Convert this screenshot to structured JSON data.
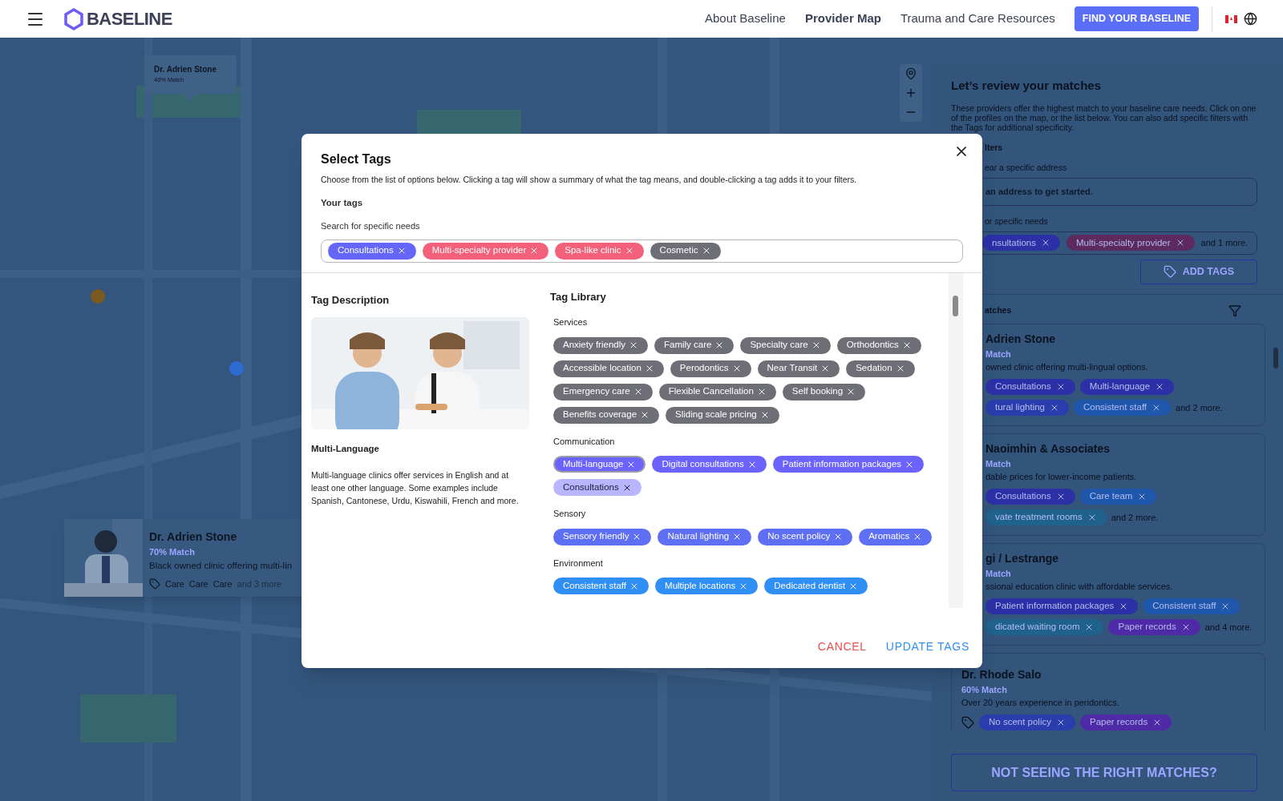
{
  "header": {
    "logo": "BASELINE",
    "nav": [
      {
        "label": "About Baseline",
        "selected": false
      },
      {
        "label": "Provider Map",
        "selected": true
      },
      {
        "label": "Trauma and Care Resources",
        "selected": false
      }
    ],
    "cta": "FIND YOUR BASELINE"
  },
  "map": {
    "popup": {
      "name": "Dr. Adrien Stone",
      "match": "40% Match"
    },
    "card": {
      "name": "Dr. Adrien Stone",
      "match": "70% Match",
      "description": "Black owned clinic offering multi-lin",
      "tags": [
        "Care",
        "Care",
        "Care"
      ],
      "more": "and 3 more"
    }
  },
  "panel": {
    "title": "Let’s review your matches",
    "intro": "These providers offer the highest match to your baseline care needs. Click on one of the profiles on the map, or the list below. You can also add specific filters with the Tags for additional specificity.",
    "filters_heading": "lters",
    "address_label": "ear a specific address",
    "address_placeholder": "an address to get started.",
    "needs_label": "or specific needs",
    "needs_tags": [
      {
        "label": "nsultations",
        "color": "#2b30a6"
      },
      {
        "label": "Multi-specialty provider",
        "color": "#5c2a5e"
      }
    ],
    "needs_more": "and 1 more.",
    "add_tags": "ADD TAGS",
    "matches_heading": "atches",
    "matches": [
      {
        "name": "Adrien Stone",
        "match": "Match",
        "description": "owned clinic offering multi-lingual options.",
        "tag_icon": false,
        "rows": [
          [
            {
              "label": "Consultations",
              "color": "#2b30a6"
            },
            {
              "label": "Multi-language",
              "color": "#2b30a6"
            }
          ],
          [
            {
              "label": "tural lighting",
              "color": "#2b3cac"
            },
            {
              "label": "Consistent staff",
              "color": "#1f57ad"
            }
          ]
        ],
        "more": "and 2 more."
      },
      {
        "name": "Naoimhin & Associates",
        "match": "Match",
        "description": "dable prices for lower-income patients.",
        "tag_icon": false,
        "rows": [
          [
            {
              "label": "Consultations",
              "color": "#2b30a6"
            },
            {
              "label": "Care team",
              "color": "#1f57ad"
            }
          ],
          [
            {
              "label": "vate treatment rooms",
              "color": "#1f628c"
            }
          ]
        ],
        "more": "and 2 more."
      },
      {
        "name": "gi / Lestrange",
        "match": "Match",
        "description": "ssional education clinic with affordable services.",
        "tag_icon": false,
        "rows": [
          [
            {
              "label": "Patient information packages",
              "color": "#2b30a6"
            },
            {
              "label": "Consistent staff",
              "color": "#1f57ad"
            }
          ],
          [
            {
              "label": "dicated waiting room",
              "color": "#1f628c"
            },
            {
              "label": "Paper records",
              "color": "#4f2aa6"
            }
          ]
        ],
        "more": "and 4 more."
      },
      {
        "name": "Dr. Rhode Salo",
        "match": "60% Match",
        "description": "Over 20 years experience in peridontics.",
        "tag_icon": true,
        "rows": [
          [
            {
              "label": "No scent policy",
              "color": "#2b3cac"
            },
            {
              "label": "Paper records",
              "color": "#4f2aa6"
            }
          ]
        ]
      }
    ],
    "bottom_button": "NOT SEEING THE RIGHT MATCHES?"
  },
  "modal": {
    "title": "Select Tags",
    "intro": "Choose from the list of options below. Clicking a tag will show a summary of what the tag means, and double-clicking a tag adds it to your filters.",
    "your_tags_heading": "Your tags",
    "search_label": "Search for specific needs",
    "your_tags": [
      {
        "label": "Consultations",
        "color": "#6366f6"
      },
      {
        "label": "Multi-specialty provider",
        "color": "#f2607a"
      },
      {
        "label": "Spa-like clinic",
        "color": "#f2607a"
      },
      {
        "label": "Cosmetic",
        "color": "#6e6e76"
      }
    ],
    "description_heading": "Tag Description",
    "description_title": "Multi-Language",
    "description_text": "Multi-language clinics offer services in English and at least one other language. Some examples include Spanish, Cantonese, Urdu, Kiswahili, French and more.",
    "library_heading": "Tag Library",
    "categories": [
      {
        "name": "Services",
        "tags": [
          {
            "label": "Anxiety friendly",
            "color": "#6e6e76",
            "selected": false,
            "added": false
          },
          {
            "label": "Family care",
            "color": "#6e6e76",
            "selected": false,
            "added": false
          },
          {
            "label": "Specialty care",
            "color": "#6e6e76",
            "selected": false,
            "added": false
          },
          {
            "label": "Orthodontics",
            "color": "#6e6e76",
            "selected": false,
            "added": false
          },
          {
            "label": "Accessible location",
            "color": "#6e6e76",
            "selected": false,
            "added": false
          },
          {
            "label": "Perodontics",
            "color": "#6e6e76",
            "selected": false,
            "added": false
          },
          {
            "label": "Near Transit",
            "color": "#6e6e76",
            "selected": false,
            "added": false
          },
          {
            "label": "Sedation",
            "color": "#6e6e76",
            "selected": false,
            "added": false
          },
          {
            "label": "Emergency care",
            "color": "#6e6e76",
            "selected": false,
            "added": false
          },
          {
            "label": "Flexible Cancellation",
            "color": "#6e6e76",
            "selected": false,
            "added": false
          },
          {
            "label": "Self booking",
            "color": "#6e6e76",
            "selected": false,
            "added": false
          },
          {
            "label": "Benefits coverage",
            "color": "#6e6e76",
            "selected": false,
            "added": false
          },
          {
            "label": "Sliding scale pricing",
            "color": "#6e6e76",
            "selected": false,
            "added": false
          }
        ]
      },
      {
        "name": "Communication",
        "tags": [
          {
            "label": "Multi-language",
            "color": "#6c63ff",
            "selected": true,
            "added": false
          },
          {
            "label": "Digital consultations",
            "color": "#6c63ff",
            "selected": false,
            "added": false
          },
          {
            "label": "Patient information packages",
            "color": "#6c63ff",
            "selected": false,
            "added": false
          },
          {
            "label": "Consultations",
            "color": "#b9b5ff",
            "selected": false,
            "added": true
          }
        ]
      },
      {
        "name": "Sensory",
        "tags": [
          {
            "label": "Sensory friendly",
            "color": "#5f6ff4",
            "selected": false,
            "added": false
          },
          {
            "label": "Natural lighting",
            "color": "#5f6ff4",
            "selected": false,
            "added": false
          },
          {
            "label": "No scent policy",
            "color": "#5f6ff4",
            "selected": false,
            "added": false
          },
          {
            "label": "Aromatics",
            "color": "#5f6ff4",
            "selected": false,
            "added": false
          }
        ]
      },
      {
        "name": "Environment",
        "tags": [
          {
            "label": "Consistent staff",
            "color": "#2f8ff5",
            "selected": false,
            "added": false
          },
          {
            "label": "Multiple locations",
            "color": "#2f8ff5",
            "selected": false,
            "added": false
          },
          {
            "label": "Dedicated dentist",
            "color": "#2f8ff5",
            "selected": false,
            "added": false
          }
        ]
      }
    ],
    "cancel": "CANCEL",
    "update": "UPDATE TAGS"
  }
}
